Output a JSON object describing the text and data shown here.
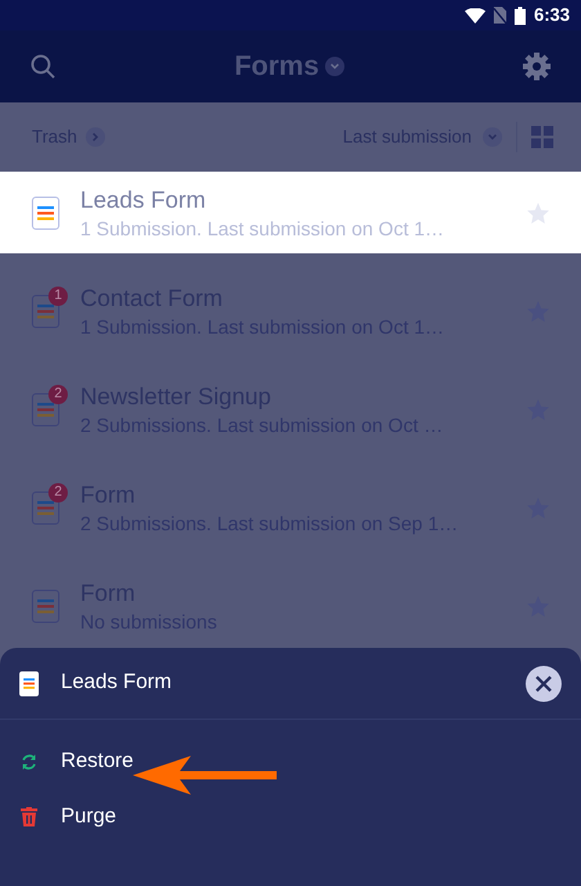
{
  "status_bar": {
    "time": "6:33"
  },
  "app_bar": {
    "title": "Forms"
  },
  "filter_bar": {
    "folder": "Trash",
    "sort": "Last submission"
  },
  "forms": [
    {
      "name": "Leads Form",
      "subtitle": "1 Submission. Last submission on Oct 1…",
      "selected": true
    },
    {
      "name": "Contact Form",
      "subtitle": "1 Submission. Last submission on Oct 1…",
      "badge": "1",
      "selected": false
    },
    {
      "name": "Newsletter Signup",
      "subtitle": "2 Submissions. Last submission on Oct …",
      "badge": "2",
      "selected": false
    },
    {
      "name": "Form",
      "subtitle": "2 Submissions. Last submission on Sep 1…",
      "badge": "2",
      "selected": false
    },
    {
      "name": "Form",
      "subtitle": "No submissions",
      "selected": false
    }
  ],
  "sheet": {
    "title": "Leads Form",
    "actions": [
      {
        "kind": "restore",
        "label": "Restore"
      },
      {
        "kind": "purge",
        "label": "Purge"
      }
    ]
  }
}
